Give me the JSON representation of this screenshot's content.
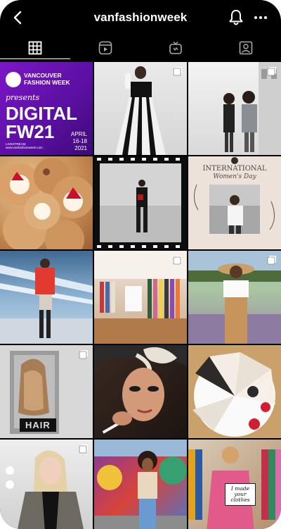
{
  "header": {
    "username": "vanfashionweek",
    "icons": [
      "back-icon",
      "notification-bell-icon",
      "more-options-icon"
    ]
  },
  "tabs": [
    {
      "name": "grid",
      "icon": "grid-icon",
      "active": true
    },
    {
      "name": "reels",
      "icon": "reels-icon",
      "active": false
    },
    {
      "name": "igtv",
      "icon": "igtv-icon",
      "active": false
    },
    {
      "name": "tagged",
      "icon": "tagged-icon",
      "active": false
    }
  ],
  "posts": [
    {
      "tile": "digital-fw21-poster",
      "multi": false
    },
    {
      "tile": "striped-gown-model",
      "multi": true
    },
    {
      "tile": "two-women-street",
      "multi": true
    },
    {
      "tile": "strawberry-donuts",
      "multi": false
    },
    {
      "tile": "film-strip-model",
      "multi": false
    },
    {
      "tile": "international-womens-day",
      "multi": false
    },
    {
      "tile": "runway-red-jacket",
      "multi": false
    },
    {
      "tile": "clothing-boutique",
      "multi": true
    },
    {
      "tile": "woman-hat-field",
      "multi": true
    },
    {
      "tile": "hair-poster",
      "multi": true
    },
    {
      "tile": "makeup-artist",
      "multi": false
    },
    {
      "tile": "cake-slices",
      "multi": false
    },
    {
      "tile": "blonde-blazer",
      "multi": true
    },
    {
      "tile": "mural-wall-woman",
      "multi": false
    },
    {
      "tile": "i-made-your-clothes",
      "multi": false
    }
  ],
  "post_texts": {
    "fw21": {
      "brand_line1": "VANCOUVER",
      "brand_line2": "FASHION WEEK",
      "presents": "presents",
      "line1": "DIGITAL",
      "line2": "FW21",
      "date_line1": "APRIL",
      "date_line2": "16-18",
      "date_line3": "2021",
      "stream_line1": "LIVESTREAM",
      "stream_line2": "www.vanfashionweek.com"
    },
    "iwd": {
      "line1": "INTERNATIONAL",
      "line2": "Women's Day"
    },
    "hair": "HAIR",
    "sign": {
      "line1": "I made",
      "line2": "your",
      "line3": "clothes"
    }
  },
  "colors": {
    "background": "#000000",
    "foreground": "#ffffff",
    "poster_purple": "#6a12b8"
  }
}
